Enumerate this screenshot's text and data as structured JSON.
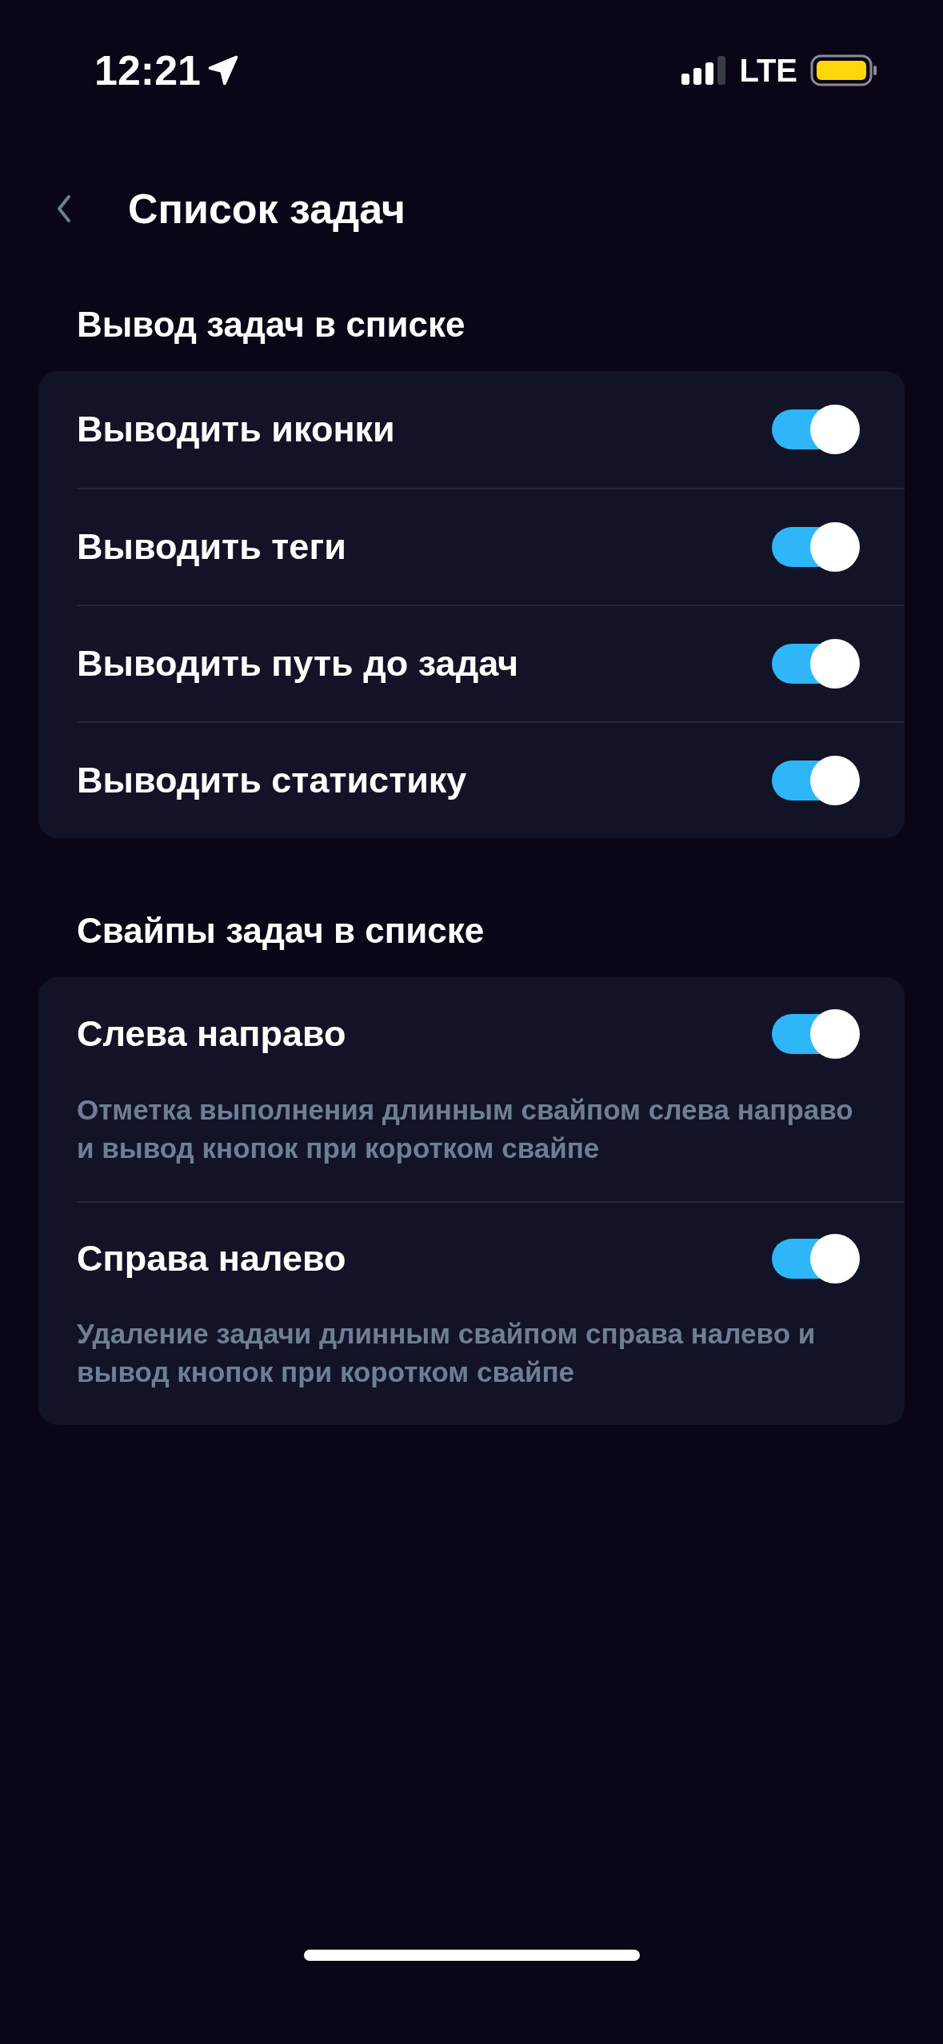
{
  "status_bar": {
    "time": "12:21",
    "network": "LTE"
  },
  "header": {
    "title": "Список задач"
  },
  "sections": [
    {
      "title": "Вывод задач в списке",
      "items": [
        {
          "label": "Выводить иконки",
          "on": true
        },
        {
          "label": "Выводить теги",
          "on": true
        },
        {
          "label": "Выводить путь до задач",
          "on": true
        },
        {
          "label": "Выводить статистику",
          "on": true
        }
      ]
    },
    {
      "title": "Свайпы задач в списке",
      "items": [
        {
          "label": "Слева направо",
          "on": true,
          "description": "Отметка выполнения длинным свайпом слева направо и вывод кнопок при коротком свайпе"
        },
        {
          "label": "Справа налево",
          "on": true,
          "description": "Удаление задачи длинным свайпом справа налево и вывод кнопок при коротком свайпе"
        }
      ]
    }
  ]
}
